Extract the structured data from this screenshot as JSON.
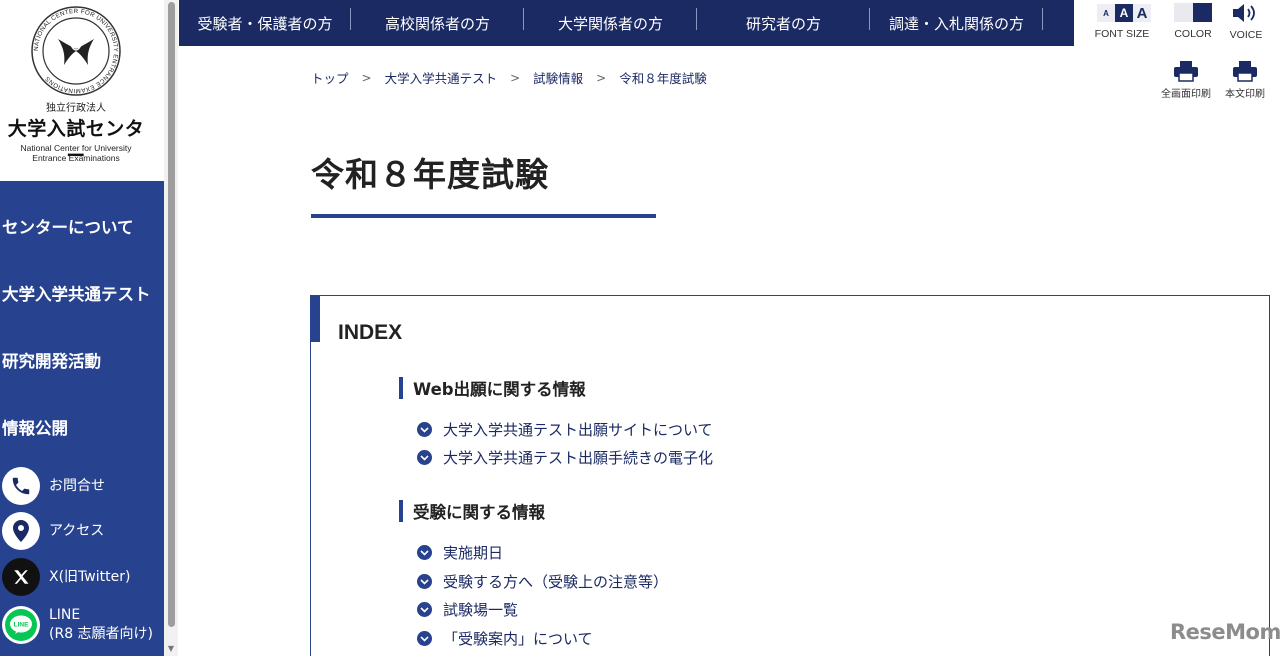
{
  "brand": {
    "org_type": "独立行政法人",
    "org_name": "大学入試センター",
    "org_en_line1": "National Center for University",
    "org_en_line2": "Entrance Examinations",
    "logo_ring_text": "NATIONAL CENTER FOR UNIVERSITY ENTRANCE EXAMINATIONS"
  },
  "sidebar": {
    "items": [
      {
        "label": "センターについて"
      },
      {
        "label": "大学入学共通テスト"
      },
      {
        "label": "研究開発活動"
      },
      {
        "label": "情報公開"
      }
    ],
    "links": [
      {
        "label": "お問合せ",
        "icon": "phone-icon"
      },
      {
        "label": "アクセス",
        "icon": "map-pin-icon"
      },
      {
        "label": "X(旧Twitter)",
        "icon": "x-logo-icon"
      },
      {
        "label_line1": "LINE",
        "label_line2": "(R8 志願者向け)",
        "icon": "line-logo-icon"
      }
    ]
  },
  "top_nav": {
    "items": [
      {
        "label": "受験者・保護者の方"
      },
      {
        "label": "高校関係者の方"
      },
      {
        "label": "大学関係者の方"
      },
      {
        "label": "研究者の方"
      },
      {
        "label": "調達・入札関係の方"
      }
    ]
  },
  "utility": {
    "font_size": {
      "small": "A",
      "medium": "A",
      "large": "A",
      "label": "FONT SIZE"
    },
    "color": {
      "label": "COLOR",
      "swatches": [
        "#e8eaef",
        "#1b2a63"
      ]
    },
    "voice": {
      "label": "VOICE"
    },
    "print_full": {
      "label": "全画面印刷"
    },
    "print_body": {
      "label": "本文印刷"
    }
  },
  "breadcrumb": {
    "items": [
      "トップ",
      "大学入学共通テスト",
      "試験情報",
      "令和８年度試験"
    ],
    "separator": ">"
  },
  "page": {
    "title": "令和８年度試験"
  },
  "index": {
    "title": "INDEX",
    "sections": [
      {
        "heading": "Web出願に関する情報",
        "links": [
          "大学入学共通テスト出願サイトについて",
          "大学入学共通テスト出願手続きの電子化"
        ]
      },
      {
        "heading": "受験に関する情報",
        "links": [
          "実施期日",
          "受験する方へ（受験上の注意等）",
          "試験場一覧",
          "「受験案内」について"
        ]
      }
    ]
  },
  "watermark": {
    "text": "ReseMom"
  },
  "colors": {
    "nav_dark": "#1b2a63",
    "sidebar_blue": "#27428e",
    "line_green": "#06c755"
  }
}
